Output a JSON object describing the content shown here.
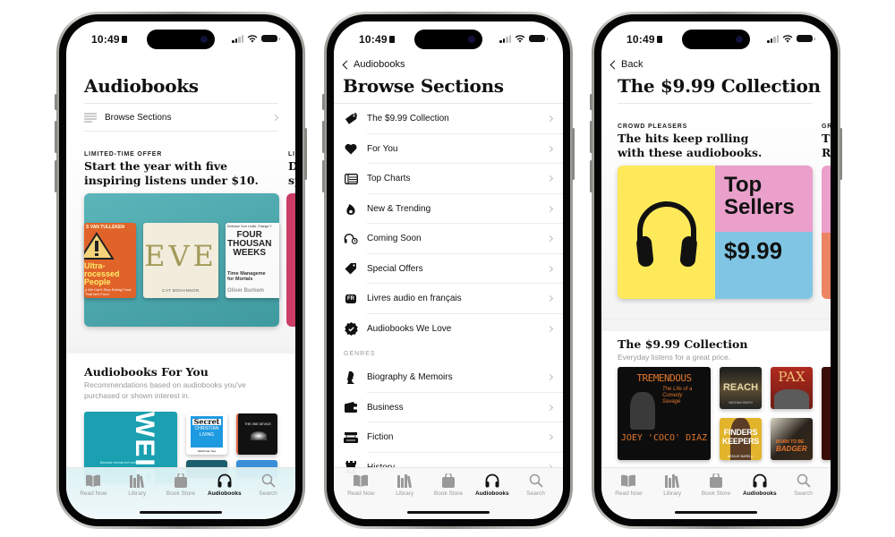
{
  "status_bar": {
    "time": "10:49"
  },
  "tab_bar": {
    "items": [
      {
        "label": "Read Now",
        "icon": "book-open-icon"
      },
      {
        "label": "Library",
        "icon": "books-icon"
      },
      {
        "label": "Book Store",
        "icon": "shopping-bag-icon"
      },
      {
        "label": "Audiobooks",
        "icon": "headphones-icon",
        "active": true
      },
      {
        "label": "Search",
        "icon": "magnifier-icon"
      }
    ]
  },
  "screen1": {
    "title": "Audiobooks",
    "browse_row": {
      "label": "Browse Sections",
      "icon": "list-icon"
    },
    "feature": {
      "eyebrow": "LIMITED-TIME OFFER",
      "headline_line1": "Start the year with five",
      "headline_line2": "inspiring listens under $10.",
      "next_eyebrow": "LIM",
      "next_headline_line1": "D",
      "next_headline_line2": "sp",
      "bg_color": "#4aa3a8",
      "next_card_color": "#cc3d66",
      "covers": [
        {
          "author": "S VAN TULLEKEN",
          "title_line1": "Ultra-",
          "title_line2": "rocessed",
          "title_line3": "People",
          "subtitle": "y We Can't Stop Eating Food That Isn't Food",
          "color": "#e0642a"
        },
        {
          "title": "EVE",
          "author": "CAT BOHANNON",
          "color": "#f1ecdc"
        },
        {
          "tagline": "Embrace Your Limits. Change Y",
          "title_line1": "FOUR",
          "title_line2": "THOUSAN",
          "title_line3": "WEEKS",
          "subtitle_line1": "Time Manageme",
          "subtitle_line2": "for Mortals",
          "author": "Oliver Burkem",
          "color": "#fafafa"
        }
      ]
    },
    "for_you": {
      "title": "Audiobooks For You",
      "subtitle_line1": "Recommendations based on audiobooks you've",
      "subtitle_line2": "purchased or shown interest in.",
      "covers": [
        {
          "title": "WEIR",
          "tagline": "Because normal isn't working",
          "color": "#1aa0b0"
        },
        {
          "title_line1": "Secret",
          "title_line2": "CHRISTIAN",
          "title_line3": "LIVING",
          "author": "Watchman Nee",
          "color": "#1e9ae0"
        },
        {
          "title": "THE ONE DEVICE",
          "color": "#111111"
        }
      ]
    }
  },
  "screen2": {
    "back_label": "Audiobooks",
    "title": "Browse Sections",
    "sections": [
      {
        "label": "The $9.99 Collection",
        "icon": "price-tag-icon"
      },
      {
        "label": "For You",
        "icon": "heart-icon"
      },
      {
        "label": "Top Charts",
        "icon": "chart-list-icon"
      },
      {
        "label": "New & Trending",
        "icon": "flame-icon"
      },
      {
        "label": "Coming Soon",
        "icon": "headphones-clock-icon"
      },
      {
        "label": "Special Offers",
        "icon": "tag-icon"
      },
      {
        "label": "Livres audio en français",
        "icon": "fr-badge-icon",
        "badge": "FR"
      },
      {
        "label": "Audiobooks We Love",
        "icon": "checkmark-seal-icon"
      }
    ],
    "genres_header": "GENRES",
    "genres": [
      {
        "label": "Biography & Memoirs",
        "icon": "person-silhouette-icon"
      },
      {
        "label": "Business",
        "icon": "wallet-icon"
      },
      {
        "label": "Fiction",
        "icon": "typewriter-icon"
      },
      {
        "label": "History",
        "icon": "castle-icon"
      }
    ]
  },
  "screen3": {
    "back_label": "Back",
    "title": "The $9.99 Collection",
    "feature": {
      "eyebrow": "CROWD PLEASERS",
      "headline_line1": "The hits keep rolling",
      "headline_line2": "with these audiobooks.",
      "next_eyebrow": "GR",
      "next_headline_line1": "T",
      "next_headline_line2": "R",
      "card_title_line1": "Top",
      "card_title_line2": "Sellers",
      "card_price": "$9.99",
      "colors": {
        "yellow": "#fde95a",
        "pink": "#eaa0cb",
        "blue": "#80c6e4",
        "orange": "#ec8463"
      }
    },
    "collection": {
      "title": "The $9.99 Collection",
      "subtitle": "Everyday listens for a great price.",
      "covers": [
        {
          "title": "TREMENDOUS",
          "subtitle": "The Life of a Comedy Savage",
          "author": "JOEY 'COCO' DIAZ",
          "color": "#0d0d0d",
          "accent": "#e0762e"
        },
        {
          "title": "REACH",
          "author": "NATHAN SMITH",
          "color": "#3a3428"
        },
        {
          "title": "PAX",
          "color": "#9c2a1c"
        },
        {
          "title_line1": "FINDERS",
          "title_line2": "KEEPERS",
          "author": "NATALIE BARELLI",
          "color": "#e2b42c"
        },
        {
          "title_line1": "BORN TO BE",
          "title_line2": "BADGER",
          "color": "#2a231c"
        }
      ]
    }
  }
}
